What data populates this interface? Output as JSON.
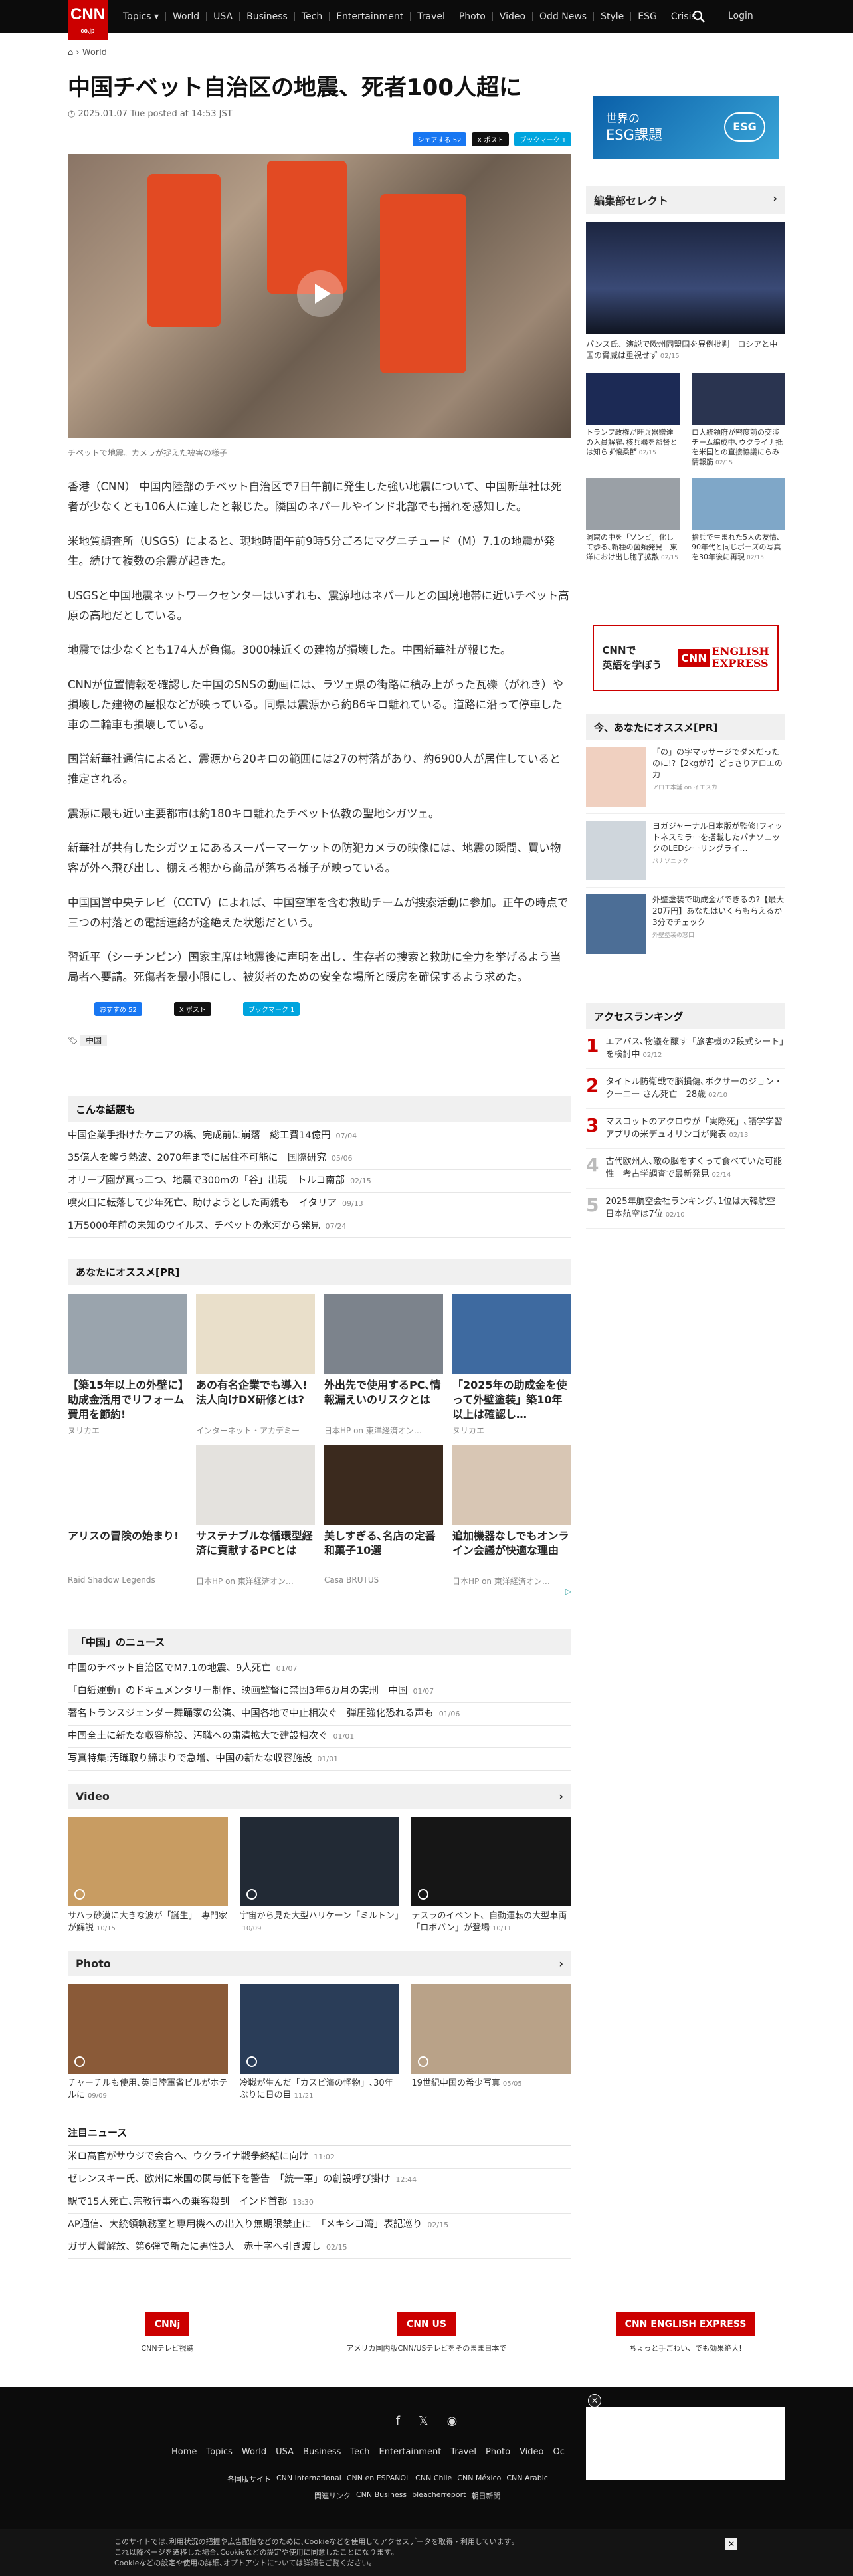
{
  "nav": {
    "logo": "CNN",
    "logo_sub": "co.jp",
    "items": [
      "Topics ▾",
      "World",
      "USA",
      "Business",
      "Tech",
      "Entertainment",
      "Travel",
      "Photo",
      "Video",
      "Odd News",
      "Style",
      "ESG",
      "Crisis"
    ],
    "login": "Login"
  },
  "breadcrumb": {
    "section": "World"
  },
  "article": {
    "title": "中国チベット自治区の地震、死者100人超に",
    "date": "2025.01.07 Tue posted at 14:53 JST",
    "share_fb": "シェアする 52",
    "share_x": "X ポスト",
    "share_hb": "ブックマーク 1",
    "image_caption": "チベットで地震。カメラが捉えた被害の様子",
    "paragraphs": [
      "香港（CNN） 中国内陸部のチベット自治区で7日午前に発生した強い地震について、中国新華社は死者が少なくとも106人に達したと報じた。隣国のネパールやインド北部でも揺れを感知した。",
      "米地質調査所（USGS）によると、現地時間午前9時5分ごろにマグニチュード（M）7.1の地震が発生。続けて複数の余震が起きた。",
      "USGSと中国地震ネットワークセンターはいずれも、震源地はネパールとの国境地帯に近いチベット高原の高地だとしている。",
      "地震では少なくとも174人が負傷。3000棟近くの建物が損壊した。中国新華社が報じた。",
      "CNNが位置情報を確認した中国のSNSの動画には、ラツェ県の街路に積み上がった瓦礫（がれき）や損壊した建物の屋根などが映っている。同県は震源から約86キロ離れている。道路に沿って停車した車の二輪車も損壊している。",
      "国営新華社通信によると、震源から20キロの範囲には27の村落があり、約6900人が居住していると推定される。",
      "震源に最も近い主要都市は約180キロ離れたチベット仏教の聖地シガツェ。",
      "新華社が共有したシガツェにあるスーパーマーケットの防犯カメラの映像には、地震の瞬間、買い物客が外へ飛び出し、棚えろ棚から商品が落ちる様子が映っている。",
      "中国国営中央テレビ（CCTV）によれば、中国空軍を含む救助チームが捜索活動に参加。正午の時点で三つの村落との電話連絡が途絶えた状態だという。",
      "習近平（シーチンピン）国家主席は地震後に声明を出し、生存者の捜索と救助に全力を挙げるよう当局者へ要請。死傷者を最小限にし、被災者のための安全な場所と暖房を確保するよう求めた。"
    ],
    "bottom_fb": "おすすめ 52",
    "bottom_x": "X ポスト",
    "bottom_hb": "ブックマーク 1",
    "tag": "中国"
  },
  "related": {
    "title": "こんな話題も",
    "items": [
      {
        "t": "中国企業手掛けたケニアの橋、完成前に崩落　総工費14億円",
        "d": "07/04"
      },
      {
        "t": "35億人を襲う熱波、2070年までに居住不可能に　国際研究",
        "d": "05/06"
      },
      {
        "t": "オリーブ園が真っ二つ、地震で300mの「谷」出現　トルコ南部",
        "d": "02/15"
      },
      {
        "t": "噴火口に転落して少年死亡、助けようとした両親も　イタリア",
        "d": "09/13"
      },
      {
        "t": "1万5000年前の未知のウイルス、チベットの氷河から発見",
        "d": "07/24"
      }
    ]
  },
  "recommend": {
    "title": "あなたにオススメ[PR]",
    "cards": [
      {
        "t": "【築15年以上の外壁に】助成金活用でリフォーム費用を節約!",
        "s": "ヌリカエ",
        "bg": "#9aa4ad"
      },
      {
        "t": "あの有名企業でも導入!法人向けDX研修とは?",
        "s": "インターネット・アカデミー",
        "bg": "#e9dfca"
      },
      {
        "t": "外出先で使用するPC､情報漏えいのリスクとは",
        "s": "日本HP on 東洋経済オン…",
        "bg": "#7c838c"
      },
      {
        "t": "「2025年の助成金を使って外壁塗装」築10年以上は確認し…",
        "s": "ヌリカエ",
        "bg": "#3e6aa0"
      },
      {
        "t": "アリスの冒険の始まり!",
        "s": "Raid Shadow Legends",
        "bg": "#ffffff"
      },
      {
        "t": "サステナブルな循環型経済に貢献するPCとは",
        "s": "日本HP on 東洋経済オン…",
        "bg": "#e4e2de"
      },
      {
        "t": "美しすぎる､名店の定番和菓子10選",
        "s": "Casa BRUTUS",
        "bg": "#3b2a1e"
      },
      {
        "t": "追加機器なしでもオンライン会議が快適な理由",
        "s": "日本HP on 東洋経済オン…",
        "bg": "#d8c6b4"
      }
    ],
    "adinfo": "▷"
  },
  "china": {
    "title": "「中国」のニュース",
    "items": [
      {
        "t": "中国のチベット自治区でM7.1の地震、9人死亡",
        "d": "01/07"
      },
      {
        "t": "「白紙運動」のドキュメンタリー制作、映画監督に禁固3年6カ月の実刑　中国",
        "d": "01/07"
      },
      {
        "t": "著名トランスジェンダー舞踊家の公演、中国各地で中止相次ぐ　弾圧強化恐れる声も",
        "d": "01/06"
      },
      {
        "t": "中国全土に新たな収容施設、汚職への粛清拡大で建設相次ぐ",
        "d": "01/01"
      },
      {
        "t": "写真特集:汚職取り締まりで急増、中国の新たな収容施設",
        "d": "01/01"
      }
    ]
  },
  "video": {
    "title": "Video",
    "more": "›",
    "items": [
      {
        "t": "サハラ砂漠に大きな波が「誕生」　専門家が解説",
        "d": "10/15",
        "bg": "#c89c62"
      },
      {
        "t": "宇宙から見た大型ハリケーン「ミルトン」",
        "d": "10/09",
        "bg": "#222a35"
      },
      {
        "t": "テスラのイベント、自動運転の大型車両「ロボバン」が登場",
        "d": "10/11",
        "bg": "#161616"
      }
    ]
  },
  "photo": {
    "title": "Photo",
    "more": "›",
    "items": [
      {
        "t": "チャーチルも使用､英旧陸軍省ビルがホテルに",
        "d": "09/09",
        "bg": "#8a5a38"
      },
      {
        "t": "冷戦が生んだ「カスピ海の怪物」､30年ぶりに日の目",
        "d": "11/21",
        "bg": "#2a3d58"
      },
      {
        "t": "19世紀中国の希少写真",
        "d": "05/05",
        "bg": "#b9a288"
      }
    ]
  },
  "hot": {
    "title": "注目ニュース",
    "items": [
      {
        "t": "米ロ高官がサウジで会合へ、ウクライナ戦争終結に向け",
        "d": "11:02"
      },
      {
        "t": "ゼレンスキー氏、欧州に米国の関与低下を警告　「統一軍」の創設呼び掛け",
        "d": "12:44"
      },
      {
        "t": "駅で15人死亡､宗教行事への乗客殺到　インド首都",
        "d": "13:30"
      },
      {
        "t": "AP通信、大統領執務室と専用機への出入り無期限禁止に　「メキシコ湾」表記巡り",
        "d": "02/15"
      },
      {
        "t": "ガザ人質解放、第6弾で新たに男性3人　赤十字へ引き渡し",
        "d": "02/15"
      }
    ]
  },
  "promos": [
    {
      "t": "CNNテレビ視聴",
      "logo": "CNNj"
    },
    {
      "t": "アメリカ国内版CNN/USテレビをそのまま日本で",
      "logo": "CNN US"
    },
    {
      "t": "ちょっと手ごわい、でも効果絶大!",
      "logo": "CNN ENGLISH EXPRESS"
    }
  ],
  "sidebar": {
    "esg_title": "世界の",
    "esg_sub": "ESG課題",
    "esg_tag": "ESG",
    "editor_title": "編集部セレクト",
    "editor_main": "パンス氏、演説で欧州同盟国を異例批判　ロシアと中国の脅威は重視せず",
    "editor_main_d": "02/15",
    "editor_items": [
      {
        "t": "トランプ政権が旺兵器贈達の入員解雇､核兵器を監督とは知らず懐柔節",
        "d": "02/15",
        "bg": "#1c2a55"
      },
      {
        "t": "ロ大統領府が密度前の交渉チーム編成中､ウクライナ抵を米国との直接協議にらみ　情報筋",
        "d": "02/15",
        "bg": "#2a3450"
      },
      {
        "t": "洞窟の中を「ゾンビ」化して歩る､新種の菌類発見　東洋におけ出し胞子拡散",
        "d": "02/15",
        "bg": "#9aa0a6"
      },
      {
        "t": "捨兵で生まれた5人の友情､90年代と同じポーズの写真を30年後に再現",
        "d": "02/15",
        "bg": "#7fa7c8"
      }
    ],
    "ee_line1": "CNNで",
    "ee_line2": "英語を学ぼう",
    "ee_logo1": "CNN",
    "ee_logo2": "ENGLISH",
    "ee_logo3": "EXPRESS",
    "pr_title": "今、あなたにオススメ[PR]",
    "pr_items": [
      {
        "t": "「の」の字マッサージでダメだったのに!?【2kgが?】どっさりアロエの力",
        "s": "アロエ本舗 on イエスカ",
        "bg": "#f0d0c0"
      },
      {
        "t": "ヨガジャーナル日本版が監修!フィットネスミラーを搭載したパナソニックのLEDシーリングライ…",
        "s": "パナソニック",
        "bg": "#cfd6dc"
      },
      {
        "t": "外壁塗装で助成金ができるの?【最大20万円】あなたはいくらもらえるか3分でチェック",
        "s": "外壁塗装の窓口",
        "bg": "#4c6e96"
      }
    ],
    "rank_title": "アクセスランキング",
    "ranks": [
      {
        "n": "1",
        "t": "エアバス､物議を醸す「旅客機の2段式シート」を検討中",
        "d": "02/12"
      },
      {
        "n": "2",
        "t": "タイトル防衛戦で脳損傷､ボクサーのジョン・クーニー さん死亡　28歳",
        "d": "02/10"
      },
      {
        "n": "3",
        "t": "マスコットのアクロウが「実際死」､語学学習アプリの米デュオリンゴが発表",
        "d": "02/13"
      },
      {
        "n": "4",
        "t": "古代欧州人､敵の脳をすくって食べていた可能性　考古学調査で最新発見",
        "d": "02/14"
      },
      {
        "n": "5",
        "t": "2025年航空会社ランキング､1位は大韓航空　日本航空は7位",
        "d": "02/10"
      }
    ]
  },
  "footer": {
    "links": [
      "Home",
      "Topics",
      "World",
      "USA",
      "Business",
      "Tech",
      "Entertainment",
      "Travel",
      "Photo",
      "Video",
      "Oc"
    ],
    "row2": [
      "各国版サイト",
      "CNN International",
      "CNN en ESPAÑOL",
      "CNN Chile",
      "CNN México",
      "CNN Arabic"
    ],
    "row3": [
      "関連リンク",
      "CNN Business",
      "bleacherreport",
      "朝日新聞"
    ]
  },
  "cookie": {
    "text": "このサイトでは､利用状況の把握や広告配信などのために､Cookieなどを使用してアクセスデータを取得・利用しています｡",
    "text2": "これ以降ページを遷移した場合､Cookieなどの設定や使用に同意したことになります｡",
    "text3": "Cookieなどの設定や使用の詳細､オプトアウトについては詳細をご覧ください｡",
    "close": "✕"
  }
}
